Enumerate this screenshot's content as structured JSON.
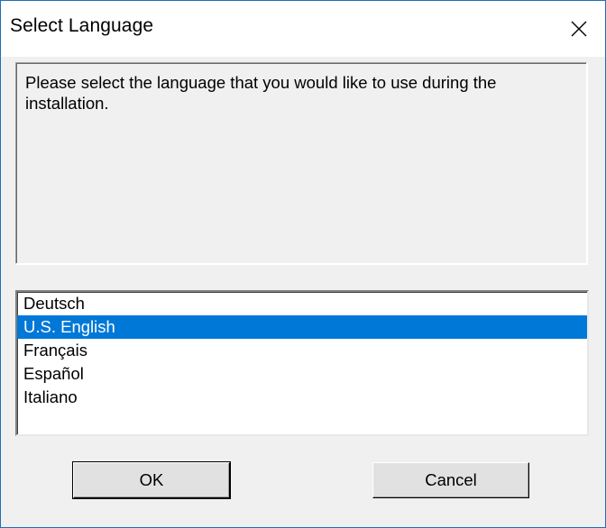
{
  "window": {
    "title": "Select Language"
  },
  "titlebar": {
    "close_icon": "close-icon"
  },
  "message": {
    "text": "Please select the language that you would like to use during the installation."
  },
  "language_list": {
    "items": [
      {
        "label": "Deutsch",
        "selected": false
      },
      {
        "label": "U.S. English",
        "selected": true
      },
      {
        "label": "Français",
        "selected": false
      },
      {
        "label": "Español",
        "selected": false
      },
      {
        "label": "Italiano",
        "selected": false
      }
    ],
    "selected_index": 1
  },
  "buttons": {
    "ok_label": "OK",
    "cancel_label": "Cancel"
  },
  "colors": {
    "selection_background": "#0078d7",
    "selection_text": "#ffffff",
    "window_border": "#1f6fb5",
    "dialog_background": "#f0f0f0"
  }
}
